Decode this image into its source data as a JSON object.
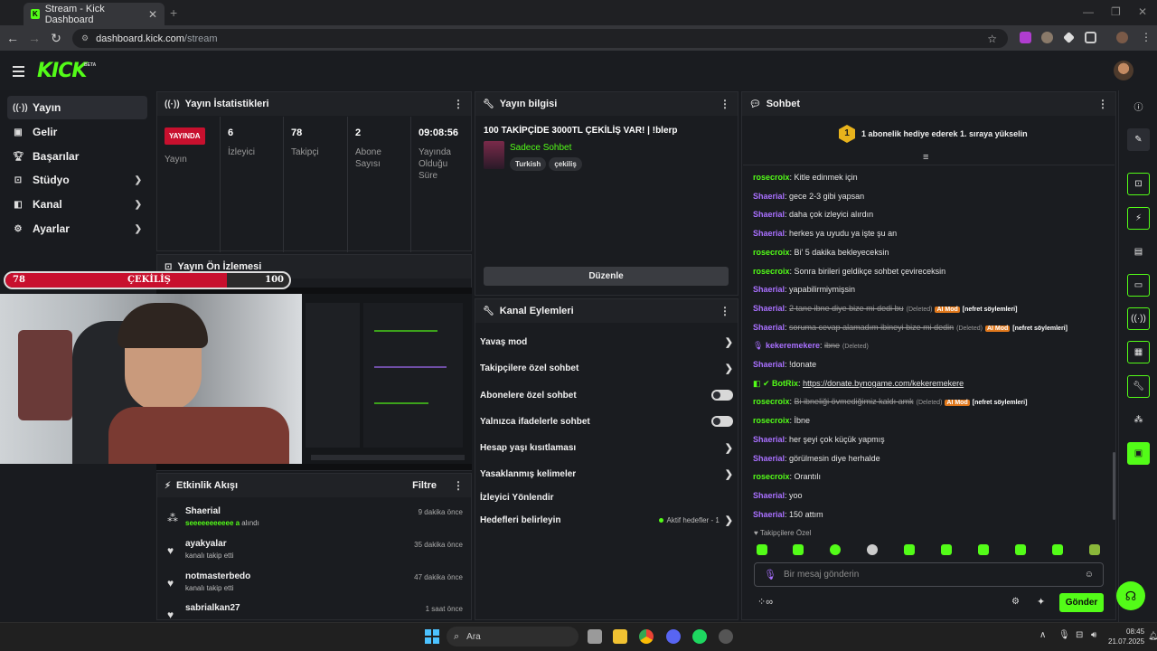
{
  "browser": {
    "tab_title": "Stream - Kick Dashboard",
    "url_host": "dashboard.kick.com",
    "url_path": "/stream"
  },
  "header": {
    "logo": "KICK",
    "beta": "BETA"
  },
  "sidebar": {
    "items": [
      {
        "label": "Yayın",
        "icon": "broadcast-icon"
      },
      {
        "label": "Gelir",
        "icon": "dollar-icon"
      },
      {
        "label": "Başarılar",
        "icon": "trophy-icon"
      },
      {
        "label": "Stüdyo",
        "icon": "studio-icon"
      },
      {
        "label": "Kanal",
        "icon": "channel-icon"
      },
      {
        "label": "Ayarlar",
        "icon": "gear-icon"
      }
    ]
  },
  "stats": {
    "title": "Yayın İstatistikleri",
    "live_badge": "YAYINDA",
    "live_label": "Yayın",
    "viewers": "6",
    "viewers_label": "İzleyici",
    "followers": "78",
    "followers_label": "Takipçi",
    "subs": "2",
    "subs_label": "Abone Sayısı",
    "uptime": "09:08:56",
    "uptime_label": "Yayında Olduğu Süre"
  },
  "preview": {
    "title": "Yayın Ön İzlemesi"
  },
  "overlay": {
    "left": "78",
    "center": "ÇEKİLİŞ",
    "right": "100",
    "progress": 0.78
  },
  "activity": {
    "title": "Etkinlik Akışı",
    "filter": "Filtre",
    "items": [
      {
        "name": "Shaerial",
        "sub_highlight": "seeeeeeeeeee a",
        "sub": " alındı",
        "time": "9 dakika önce"
      },
      {
        "name": "ayakyalar",
        "sub": "kanalı takip etti",
        "time": "35 dakika önce"
      },
      {
        "name": "notmasterbedo",
        "sub": "kanalı takip etti",
        "time": "47 dakika önce"
      },
      {
        "name": "sabrialkan27",
        "sub": "",
        "time": "1 saat önce"
      }
    ]
  },
  "info": {
    "title": "Yayın bilgisi",
    "stream_title": "100 TAKİPÇİDE 3000TL ÇEKİLİŞ VAR! | !blerp",
    "category": "Sadece Sohbet",
    "tags": [
      "Turkish",
      "çekiliş"
    ],
    "edit": "Düzenle"
  },
  "actions": {
    "title": "Kanal Eylemleri",
    "items": [
      "Yavaş mod",
      "Takipçilere özel sohbet",
      "Abonelere özel sohbet",
      "Yalnızca ifadelerle sohbet",
      "Hesap yaşı kısıtlaması",
      "Yasaklanmış kelimeler",
      "İzleyici Yönlendir",
      "Hedefleri belirleyin"
    ],
    "goals_status": "Aktif hedefler - 1"
  },
  "chat": {
    "title": "Sohbet",
    "rank": "1",
    "banner": "1 abonelik hediye ederek 1. sıraya yükselin",
    "followers_only": "Takipçilere Özel",
    "placeholder": "Bir mesaj gönderin",
    "send": "Gönder",
    "messages": [
      {
        "user": "rosecroix",
        "c": "g",
        "text": "Kitle edinmek için"
      },
      {
        "user": "Shaerial",
        "c": "p",
        "text": "gece 2-3 gibi yapsan"
      },
      {
        "user": "Shaerial",
        "c": "p",
        "text": "daha çok izleyici alırdın"
      },
      {
        "user": "Shaerial",
        "c": "p",
        "text": "herkes ya uyudu ya işte şu an"
      },
      {
        "user": "rosecroix",
        "c": "g",
        "text": "Bi' 5 dakika bekleyeceksin"
      },
      {
        "user": "rosecroix",
        "c": "g",
        "text": "Sonra birileri geldikçe sohbet çevireceksin"
      },
      {
        "user": "Shaerial",
        "c": "p",
        "text": "yapabilirmiymişsin"
      },
      {
        "user": "Shaerial",
        "c": "p",
        "text": "2 tane ibne diye bize mi dedi bu",
        "deleted": "(Deleted)",
        "mod": "AI Mod",
        "tag": "[nefret söylemleri]"
      },
      {
        "user": "Shaerial",
        "c": "p",
        "text": "soruma cevap alamadım ibineyi bize mi dedin",
        "deleted": "(Deleted)",
        "mod": "AI Mod",
        "tag": "[nefret söylemleri]"
      },
      {
        "user": "kekeremekere",
        "c": "p",
        "text": "ibne",
        "deleted": "(Deleted)"
      },
      {
        "user": "Shaerial",
        "c": "p",
        "text": "!donate"
      },
      {
        "user": "BotRix",
        "c": "g",
        "text": "https://donate.bynogame.com/kekeremekere",
        "link": true
      },
      {
        "user": "rosecroix",
        "c": "g",
        "text": "Bi ibneliği övmediğimiz kaldı amk",
        "deleted": "(Deleted)",
        "mod": "AI Mod",
        "tag": "[nefret söylemleri]"
      },
      {
        "user": "rosecroix",
        "c": "g",
        "text": "İbne"
      },
      {
        "user": "Shaerial",
        "c": "p",
        "text": "her şeyi çok küçük yapmış"
      },
      {
        "user": "Shaerial",
        "c": "p",
        "text": "görülmesin diye herhalde"
      },
      {
        "user": "rosecroix",
        "c": "g",
        "text": "Orantılı"
      },
      {
        "user": "Shaerial",
        "c": "p",
        "text": "yoo"
      },
      {
        "user": "Shaerial",
        "c": "p",
        "text": "150 attım"
      }
    ]
  },
  "taskbar": {
    "search": "Ara",
    "time": "08:45",
    "date": "21.07.2025"
  },
  "colors": {
    "accent": "#53fc18",
    "live": "#c8102e",
    "purple": "#a970ff"
  }
}
